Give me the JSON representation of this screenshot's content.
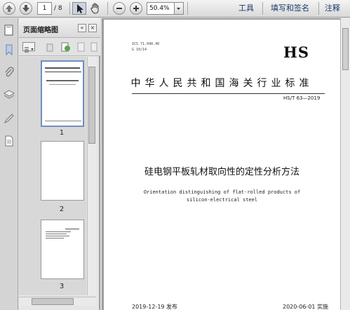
{
  "toolbar": {
    "page_current": "1",
    "page_total": "/ 8",
    "zoom": "50.4%",
    "menus": [
      "工具",
      "填写和签名",
      "注释"
    ]
  },
  "thumbnail_panel": {
    "title": "页面缩略图",
    "thumbnails": [
      {
        "label": "1"
      },
      {
        "label": "2"
      },
      {
        "label": "3"
      }
    ]
  },
  "document": {
    "ics": "ICS 71.040.40",
    "ccs": "G 10/14",
    "logo": "HS",
    "standard_title": "中华人民共和国海关行业标准",
    "standard_code": "HS/T 63—2019",
    "title_cn": "硅电钢平板轧材取向性的定性分析方法",
    "title_en_line1": "Orientation distinguishing of flat-rolled products of",
    "title_en_line2": "silicon-electrical steel",
    "release_date": "2019-12-19 发布",
    "implement_date": "2020-06-01 实施"
  },
  "colors": {
    "menu_text": "#1a3a6a",
    "thumb_border_selected": "#6f8fbf"
  }
}
